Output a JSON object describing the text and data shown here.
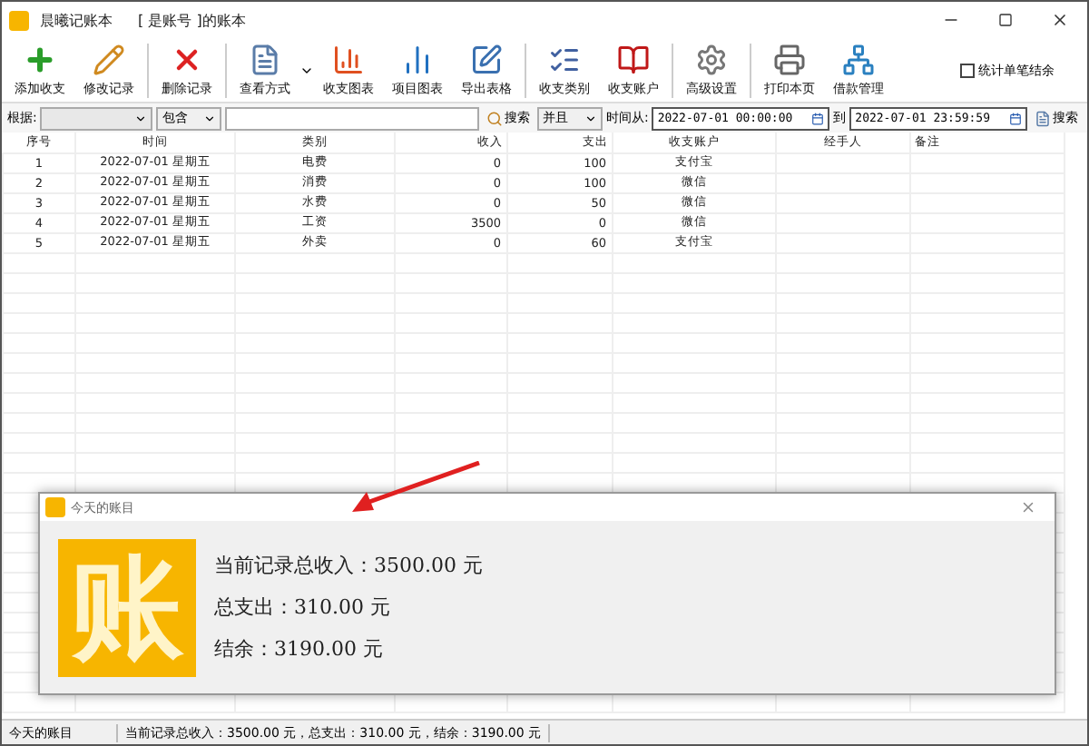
{
  "window": {
    "app_title": "晨曦记账本",
    "book_title": "[ 是账号 ]的账本"
  },
  "toolbar": [
    {
      "label": "添加收支",
      "kind": "add"
    },
    {
      "label": "修改记录",
      "kind": "edit"
    },
    {
      "label": "删除记录",
      "kind": "delete"
    },
    {
      "label": "查看方式",
      "kind": "view"
    },
    {
      "label": "收支图表",
      "kind": "chart"
    },
    {
      "label": "项目图表",
      "kind": "chart3d"
    },
    {
      "label": "导出表格",
      "kind": "export"
    },
    {
      "label": "收支类别",
      "kind": "category"
    },
    {
      "label": "收支账户",
      "kind": "account"
    },
    {
      "label": "高级设置",
      "kind": "settings"
    },
    {
      "label": "打印本页",
      "kind": "print"
    },
    {
      "label": "借款管理",
      "kind": "loan"
    }
  ],
  "stat_checkbox": {
    "label": "统计单笔结余",
    "checked": false
  },
  "search": {
    "by_label": "根据:",
    "match_value": "包含",
    "search_button": "搜索",
    "logic_value": "并且",
    "from_label": "时间从:",
    "from_value": "2022-07-01 00:00:00",
    "to_label": "到",
    "to_value": "2022-07-01 23:59:59",
    "search_button_2": "搜索"
  },
  "table": {
    "columns": [
      "序号",
      "时间",
      "类别",
      "收入",
      "支出",
      "收支账户",
      "经手人",
      "备注"
    ],
    "rows": [
      [
        "1",
        "2022-07-01 星期五",
        "电费",
        "0",
        "100",
        "支付宝",
        "",
        ""
      ],
      [
        "2",
        "2022-07-01 星期五",
        "消费",
        "0",
        "100",
        "微信",
        "",
        ""
      ],
      [
        "3",
        "2022-07-01 星期五",
        "水费",
        "0",
        "50",
        "微信",
        "",
        ""
      ],
      [
        "4",
        "2022-07-01 星期五",
        "工资",
        "3500",
        "0",
        "微信",
        "",
        ""
      ],
      [
        "5",
        "2022-07-01 星期五",
        "外卖",
        "0",
        "60",
        "支付宝",
        "",
        ""
      ]
    ]
  },
  "dialog": {
    "title": "今天的账目",
    "logo_char": "账",
    "lines": [
      "当前记录总收入：3500.00 元",
      "总支出：310.00 元",
      "结余：3190.00 元"
    ]
  },
  "status_bar": {
    "label": "今天的账目",
    "summary": "当前记录总收入：3500.00 元，总支出：310.00 元，结余：3190.00 元"
  }
}
